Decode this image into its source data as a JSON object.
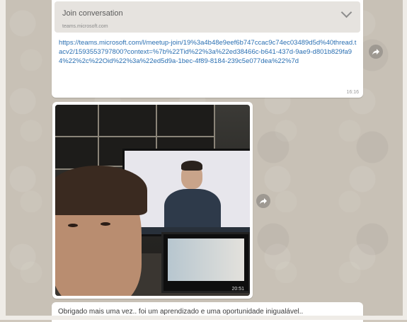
{
  "link_message": {
    "preview_title": "Join conversation",
    "preview_domain": "teams.microsoft.com",
    "url": "https://teams.microsoft.com/l/meetup-join/19%3a4b48e9eef6b747ccac9c74ec03489d5d%40thread.tacv2/1593553797800?context=%7b%22Tid%22%3a%22ed38466c-b641-437d-9ae9-d801b829fa94%22%2c%22Oid%22%3a%22ed5d9a-1bec-4f89-8184-239c5e077dea%22%7d",
    "time": "16:16"
  },
  "image_message": {
    "time": "20:51"
  },
  "text_message": {
    "text": "Obrigado mais uma vez.. foi um aprendizado e uma oportunidade  inigualável.."
  },
  "icons": {
    "forward": "forward-arrow-icon",
    "chevron": "chevron-down-icon"
  }
}
